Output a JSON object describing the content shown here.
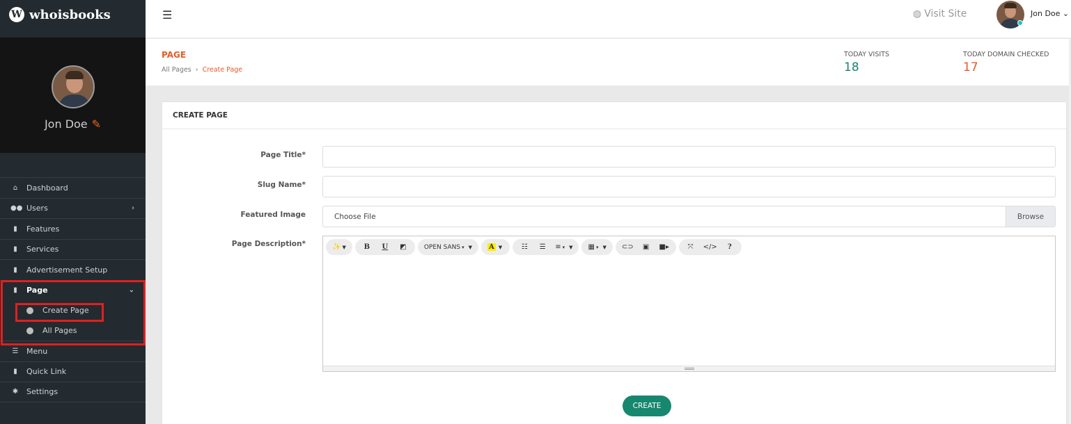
{
  "brand": {
    "name": "whoisbooks",
    "logo_letter": "W"
  },
  "profile": {
    "name": "Jon Doe"
  },
  "sidebar": {
    "items": [
      {
        "label": "Dashboard",
        "icon": "home-icon"
      },
      {
        "label": "Users",
        "icon": "users-icon",
        "chevron": "›"
      },
      {
        "label": "Features",
        "icon": "pages-icon"
      },
      {
        "label": "Services",
        "icon": "pages-icon"
      },
      {
        "label": "Advertisement Setup",
        "icon": "pages-icon"
      },
      {
        "label": "Page",
        "icon": "pages-icon",
        "chevron": "⌄"
      },
      {
        "label": "Menu",
        "icon": "list-icon"
      },
      {
        "label": "Quick Link",
        "icon": "pages-icon"
      },
      {
        "label": "Settings",
        "icon": "gear-icon"
      }
    ],
    "page_submenu": [
      {
        "label": "Create Page"
      },
      {
        "label": "All Pages"
      }
    ]
  },
  "topbar": {
    "visit_site": "Visit Site",
    "user_name": "Jon Doe",
    "user_caret": "⌄"
  },
  "header": {
    "title": "PAGE",
    "breadcrumb": [
      "All Pages",
      "›",
      "Create Page"
    ],
    "stats": [
      {
        "label": "TODAY VISITS",
        "value": "18",
        "color": "#18856f"
      },
      {
        "label": "TODAY DOMAIN CHECKED",
        "value": "17",
        "color": "#e85a24"
      }
    ]
  },
  "form": {
    "card_title": "CREATE PAGE",
    "page_title_label": "Page Title*",
    "page_title_value": "",
    "slug_label": "Slug Name*",
    "slug_value": "",
    "image_label": "Featured Image",
    "file_text": "Choose File",
    "browse_label": "Browse",
    "description_label": "Page Description*",
    "font_name": "OPEN SANS",
    "submit_label": "CREATE"
  },
  "colors": {
    "accent": "#e85a24",
    "primary": "#17876f",
    "sidebar": "#242b30",
    "highlight": "#e02020"
  }
}
